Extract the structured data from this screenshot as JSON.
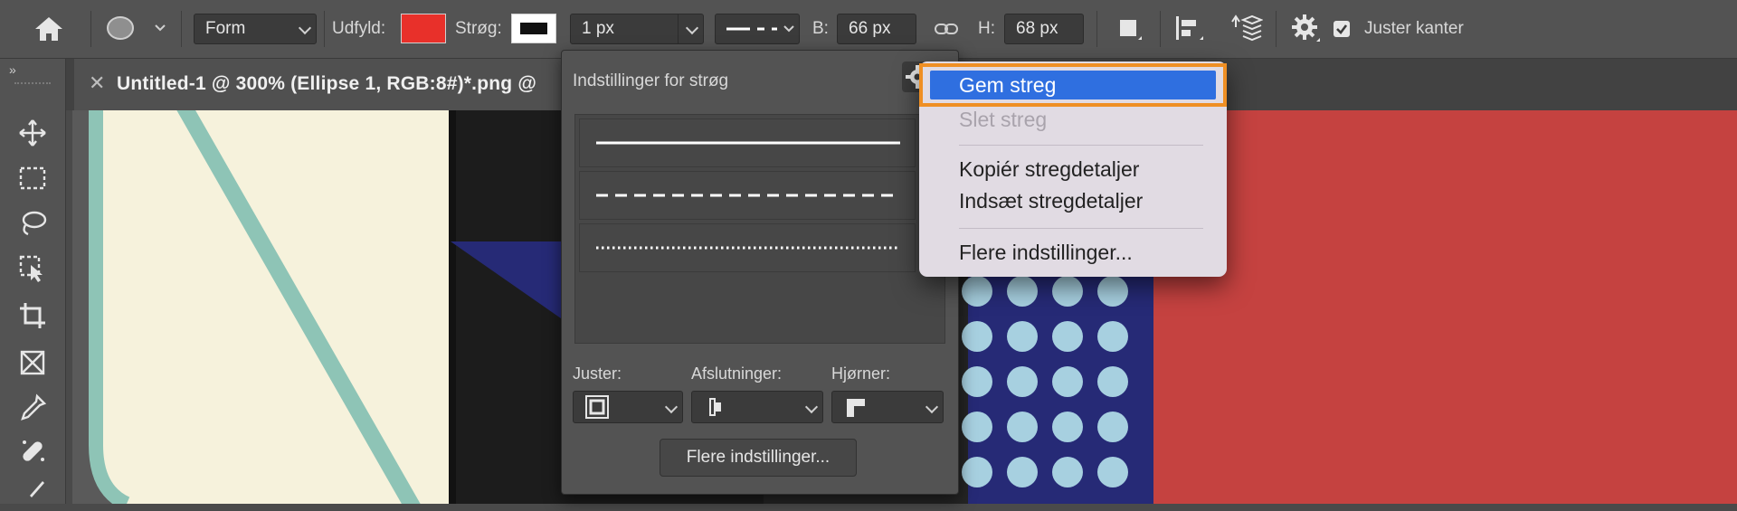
{
  "optionsbar": {
    "mode": "Form",
    "fill_label": "Udfyld:",
    "fill_color": "#e8302a",
    "stroke_label": "Strøg:",
    "stroke_width": "1 px",
    "width_label": "B:",
    "width_value": "66 px",
    "height_label": "H:",
    "height_value": "68 px",
    "align_edges_label": "Juster kanter",
    "align_edges_checked": true
  },
  "document": {
    "tab_title": "Untitled-1 @ 300% (Ellipse 1, RGB:8#)*.png @"
  },
  "stroke_panel": {
    "title": "Indstillinger for strøg",
    "align_label": "Juster:",
    "caps_label": "Afslutninger:",
    "corners_label": "Hjørner:",
    "more_button": "Flere indstillinger..."
  },
  "menu": {
    "items": [
      {
        "label": "Gem streg",
        "state": "highlighted"
      },
      {
        "label": "Slet streg",
        "state": "disabled"
      },
      {
        "label": "Kopiér stregdetaljer",
        "state": "enabled"
      },
      {
        "label": "Indsæt stregdetaljer",
        "state": "enabled"
      },
      {
        "label": "Flere indstillinger...",
        "state": "enabled"
      }
    ]
  },
  "colors": {
    "accent_highlight": "#2f6fe0",
    "focus_outline": "#ef8f24",
    "canvas_red": "#c54240",
    "canvas_navy": "#262a76",
    "canvas_cream": "#f6f2dc",
    "canvas_teal": "#8ec4b6",
    "dot_blue": "#a7d0e0"
  }
}
